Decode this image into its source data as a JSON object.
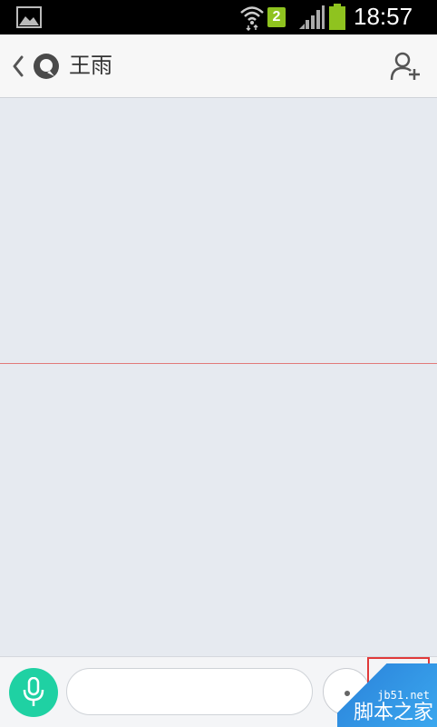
{
  "status_bar": {
    "sim_slot": "2",
    "time": "18:57",
    "battery_color": "#8fc31f"
  },
  "header": {
    "back_icon": "chevron-left-icon",
    "avatar_icon": "avatar",
    "contact_name": "王雨",
    "add_contact_icon": "add-person-icon"
  },
  "input_bar": {
    "mic_icon": "microphone-icon",
    "mic_color": "#1fd1a3",
    "message_placeholder": "",
    "emoji_icon": "emoji-icon",
    "plus_icon": "plus-icon"
  },
  "watermark": {
    "url": "jb51.net",
    "name": "脚本之家"
  }
}
